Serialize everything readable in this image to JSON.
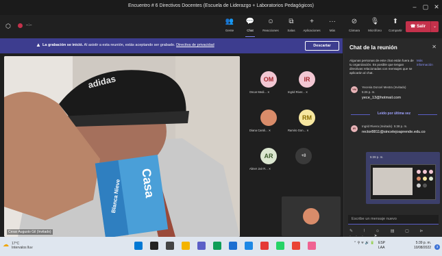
{
  "window": {
    "title": "Encuentro # 6 Directivos Docentes (Escuela de Liderazgo + Laboratorios Pedagógicos)",
    "min": "–",
    "max": "▢",
    "close": "✕"
  },
  "toolbar": {
    "items": [
      {
        "label": "Gente",
        "icon": "people-icon",
        "glyph": "👥"
      },
      {
        "label": "Chat",
        "icon": "chat-icon",
        "glyph": "💬"
      },
      {
        "label": "Reacciones",
        "icon": "reactions-icon",
        "glyph": "☺"
      },
      {
        "label": "Salas",
        "icon": "rooms-icon",
        "glyph": "⧉"
      },
      {
        "label": "Aplicaciones",
        "icon": "apps-icon",
        "glyph": "+"
      },
      {
        "label": "Más",
        "icon": "more-icon",
        "glyph": "···"
      },
      {
        "label": "Cámara",
        "icon": "camera-off-icon",
        "glyph": "⊘"
      },
      {
        "label": "Micrófono",
        "icon": "mic-off-icon",
        "glyph": "🎙"
      },
      {
        "label": "Compartir",
        "icon": "share-icon",
        "glyph": "⬆"
      }
    ],
    "leave_label": "Salir",
    "leave_dropdown": "⌄"
  },
  "banner": {
    "bold": "La grabación se inició.",
    "text": " Al asistir a esta reunión, estás aceptando ser grabado.",
    "link": "Directiva de privacidad",
    "dismiss": "Descartar"
  },
  "main_video": {
    "name": "Cesar Augusto Gil (Invitado)",
    "cap_text": "adidas",
    "box_text": "Casa",
    "box_sub": "Blanca Nieve"
  },
  "participants": [
    {
      "initials": "OM",
      "name": "Oscar Medi...",
      "color": "#f2c7d3",
      "text_color": "#a4262c"
    },
    {
      "initials": "IR",
      "name": "Ingrid River...",
      "color": "#f2c7d3",
      "text_color": "#a4262c"
    },
    {
      "initials": "",
      "name": "Diana Caroli...",
      "color": "#d98c6a",
      "text_color": "#fff"
    },
    {
      "initials": "RM",
      "name": "Ramiro Gon...",
      "color": "#f7e7a0",
      "text_color": "#8a6d00"
    },
    {
      "initials": "AR",
      "name": "Abner Jair R...",
      "color": "#dbe6d0",
      "text_color": "#3b5a2b"
    }
  ],
  "more_participants": "+8",
  "chat": {
    "title": "Chat de la reunión",
    "close": "✕",
    "notice": "Algunas personas de este chat están fuera de tu organización. Es posible que tengan directivas relacionadas con mensajes que se aplicarán al chat.",
    "notice_link": "Más información",
    "messages": [
      {
        "avatar": "YM",
        "sender": "Yecenia Doncel Mestra (Invitado)",
        "time": "5:26 p. m.",
        "body": "yece_13@hotmail.com"
      },
      {
        "avatar": "IR",
        "sender": "Ingrid Rivera (Invitado)",
        "time": "5:38 p. m.",
        "body": "rector8811@sincelejoaprende.edu.co"
      }
    ],
    "read_marker": "Leído por última vez",
    "image_time": "5:39 p. m.",
    "compose_placeholder": "Escribe un mensaje nuevo",
    "compose_tools": "✎ ! ☺ ▤ ▢ ⊳ ··· ➤"
  },
  "taskbar": {
    "temp": "17°C",
    "weather": "Intervalos lluv",
    "lang1": "ESP",
    "lang2": "LAA",
    "time": "5:39 p. m.",
    "date": "10/08/2022",
    "notif": "3",
    "tray": "⌃  ⚲  ᯤ  🔊  🔋",
    "apps": [
      "#0078d4",
      "#222",
      "#444",
      "#f4b400",
      "#5b5fc7",
      "#0f9d58",
      "#1d6fd1",
      "#1e88e5",
      "#e53935",
      "#25d366",
      "#ea4335",
      "#f06292"
    ]
  }
}
